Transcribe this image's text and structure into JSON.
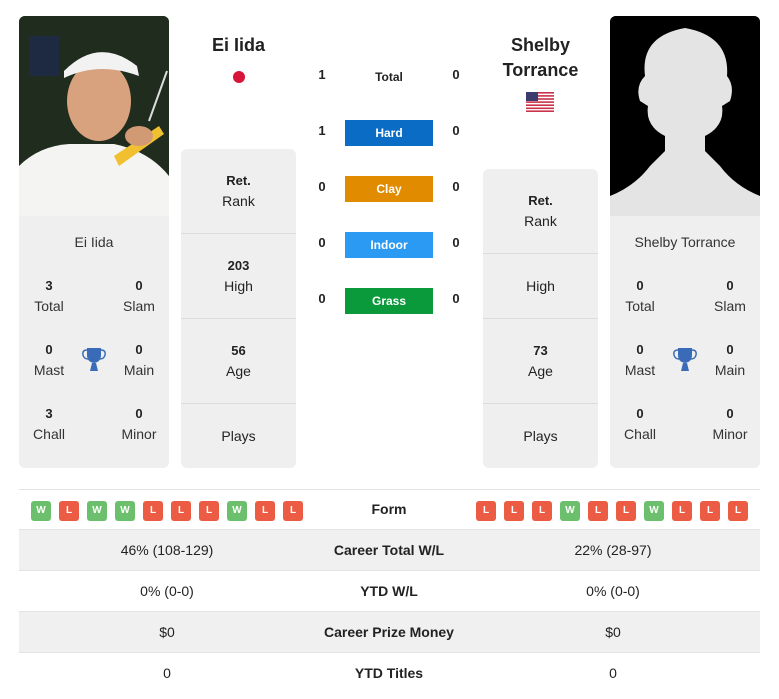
{
  "player1": {
    "name": "Ei Iida",
    "card_name": "Ei Iida",
    "country_flag": "japan-flag",
    "titles": {
      "total": {
        "value": "3",
        "label": "Total"
      },
      "slam": {
        "value": "0",
        "label": "Slam"
      },
      "mast": {
        "value": "0",
        "label": "Mast"
      },
      "main": {
        "value": "0",
        "label": "Main"
      },
      "chall": {
        "value": "3",
        "label": "Chall"
      },
      "minor": {
        "value": "0",
        "label": "Minor"
      }
    },
    "rank_panel": {
      "rank": {
        "value": "Ret.",
        "label": "Rank"
      },
      "high": {
        "value": "203",
        "label": "High"
      },
      "age": {
        "value": "56",
        "label": "Age"
      },
      "plays": {
        "value": "",
        "label": "Plays"
      }
    },
    "form": [
      "W",
      "L",
      "W",
      "W",
      "L",
      "L",
      "L",
      "W",
      "L",
      "L"
    ]
  },
  "player2": {
    "name": "Shelby Torrance",
    "name_line1": "Shelby",
    "name_line2": "Torrance",
    "card_name": "Shelby Torrance",
    "country_flag": "usa-flag",
    "titles": {
      "total": {
        "value": "0",
        "label": "Total"
      },
      "slam": {
        "value": "0",
        "label": "Slam"
      },
      "mast": {
        "value": "0",
        "label": "Mast"
      },
      "main": {
        "value": "0",
        "label": "Main"
      },
      "chall": {
        "value": "0",
        "label": "Chall"
      },
      "minor": {
        "value": "0",
        "label": "Minor"
      }
    },
    "rank_panel": {
      "rank": {
        "value": "Ret.",
        "label": "Rank"
      },
      "high": {
        "value": "",
        "label": "High"
      },
      "age": {
        "value": "73",
        "label": "Age"
      },
      "plays": {
        "value": "",
        "label": "Plays"
      }
    },
    "form": [
      "L",
      "L",
      "L",
      "W",
      "L",
      "L",
      "W",
      "L",
      "L",
      "L"
    ]
  },
  "h2h": {
    "surfaces": [
      {
        "label": "Total",
        "p1": "1",
        "p2": "0",
        "color": ""
      },
      {
        "label": "Hard",
        "p1": "1",
        "p2": "0",
        "color": "#0a6cc4"
      },
      {
        "label": "Clay",
        "p1": "0",
        "p2": "0",
        "color": "#e08b00"
      },
      {
        "label": "Indoor",
        "p1": "0",
        "p2": "0",
        "color": "#2a9af3"
      },
      {
        "label": "Grass",
        "p1": "0",
        "p2": "0",
        "color": "#0a9a3c"
      }
    ]
  },
  "comparison": {
    "form_label": "Form",
    "rows": [
      {
        "label": "Career Total W/L",
        "p1": "46% (108-129)",
        "p2": "22% (28-97)"
      },
      {
        "label": "YTD W/L",
        "p1": "0% (0-0)",
        "p2": "0% (0-0)"
      },
      {
        "label": "Career Prize Money",
        "p1": "$0",
        "p2": "$0"
      },
      {
        "label": "YTD Titles",
        "p1": "0",
        "p2": "0"
      }
    ]
  },
  "colors": {
    "win": "#6cbf6c",
    "loss": "#ec5b43",
    "trophy": "#3a6bb8"
  }
}
